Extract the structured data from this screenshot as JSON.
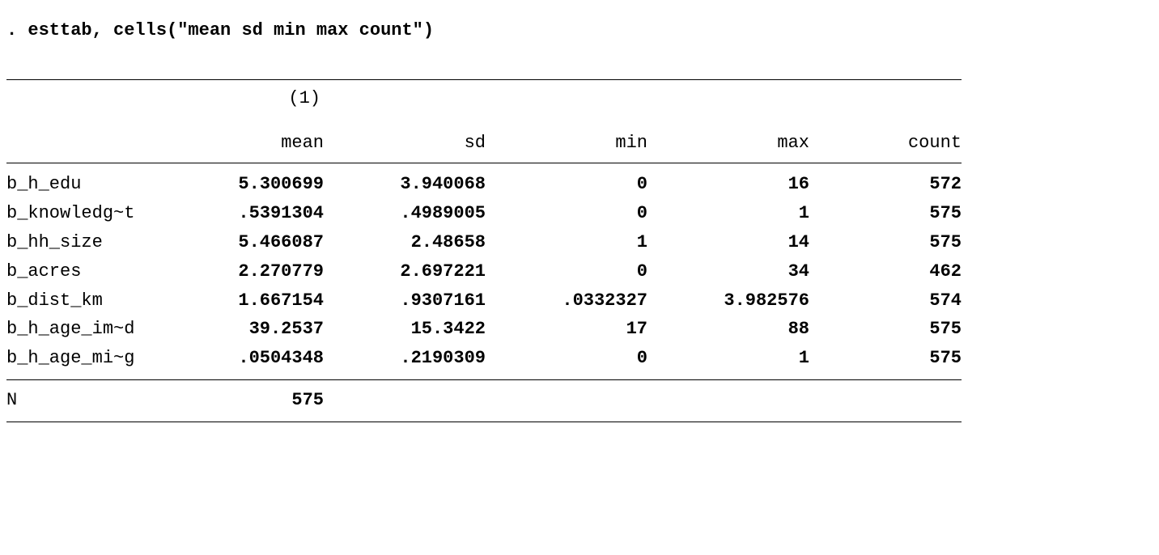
{
  "command": ". esttab, cells(\"mean sd min max count\")",
  "model_label": "(1)",
  "headers": {
    "mean": "mean",
    "sd": "sd",
    "min": "min",
    "max": "max",
    "count": "count"
  },
  "rows": [
    {
      "var": "b_h_edu",
      "mean": "5.300699",
      "sd": "3.940068",
      "min": "0",
      "max": "16",
      "count": "572"
    },
    {
      "var": "b_knowledg~t",
      "mean": ".5391304",
      "sd": ".4989005",
      "min": "0",
      "max": "1",
      "count": "575"
    },
    {
      "var": "b_hh_size",
      "mean": "5.466087",
      "sd": "2.48658",
      "min": "1",
      "max": "14",
      "count": "575"
    },
    {
      "var": "b_acres",
      "mean": "2.270779",
      "sd": "2.697221",
      "min": "0",
      "max": "34",
      "count": "462"
    },
    {
      "var": "b_dist_km",
      "mean": "1.667154",
      "sd": ".9307161",
      "min": ".0332327",
      "max": "3.982576",
      "count": "574"
    },
    {
      "var": "b_h_age_im~d",
      "mean": "39.2537",
      "sd": "15.3422",
      "min": "17",
      "max": "88",
      "count": "575"
    },
    {
      "var": "b_h_age_mi~g",
      "mean": ".0504348",
      "sd": ".2190309",
      "min": "0",
      "max": "1",
      "count": "575"
    }
  ],
  "footer": {
    "label": "N",
    "value": "575"
  }
}
